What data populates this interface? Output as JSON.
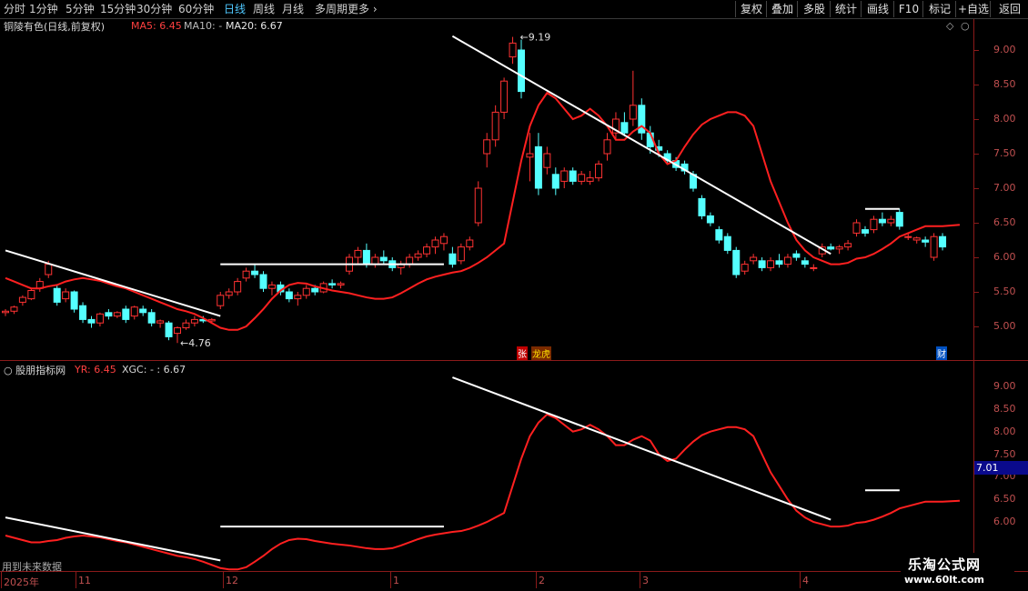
{
  "toolbar": {
    "timeframes": [
      "分时",
      "1分钟",
      "5分钟",
      "15分钟",
      "30分钟",
      "60分钟",
      "日线",
      "周线",
      "月线",
      "多周期",
      "更多"
    ],
    "active": "日线",
    "right_buttons": [
      "复权",
      "叠加",
      "多股",
      "统计",
      "画线",
      "F10",
      "标记",
      "+自选",
      "返回"
    ]
  },
  "main": {
    "stock_name": "铜陵有色(日线,前复权)",
    "ma5_label": "MA5: 6.45",
    "ma10_label": "MA10: -",
    "ma20_label": "MA20: 6.67",
    "high_label": "9.19",
    "low_label": "4.76",
    "yaxis": [
      "9.00",
      "8.50",
      "8.00",
      "7.50",
      "7.00",
      "6.50",
      "6.00",
      "5.50",
      "5.00"
    ],
    "marks": {
      "zhang": "张",
      "longhu": "龙虎",
      "cai": "财"
    }
  },
  "indicator": {
    "title": "股朋指标网",
    "yr": "YR: 6.45",
    "xgc": "XGC: - : 6.67",
    "yaxis": [
      "9.00",
      "8.50",
      "8.00",
      "7.50",
      "7.00",
      "6.50",
      "6.00"
    ],
    "current_value": "7.01",
    "note": "用到未来数据"
  },
  "dates": [
    "2025年",
    "11",
    "12",
    "1",
    "2",
    "3",
    "4"
  ],
  "watermark": {
    "line1": "乐淘公式网",
    "line2": "www.60lt.com"
  },
  "chart_data": {
    "type": "candlestick",
    "ylim": [
      4.6,
      9.4
    ],
    "candles": [
      [
        5.2,
        5.25,
        5.15,
        5.22
      ],
      [
        5.22,
        5.3,
        5.18,
        5.28
      ],
      [
        5.35,
        5.45,
        5.3,
        5.42
      ],
      [
        5.4,
        5.55,
        5.38,
        5.52
      ],
      [
        5.55,
        5.7,
        5.5,
        5.65
      ],
      [
        5.75,
        5.95,
        5.7,
        5.9
      ],
      [
        5.55,
        5.6,
        5.3,
        5.35
      ],
      [
        5.4,
        5.55,
        5.35,
        5.5
      ],
      [
        5.5,
        5.52,
        5.2,
        5.25
      ],
      [
        5.3,
        5.35,
        5.05,
        5.1
      ],
      [
        5.1,
        5.15,
        4.98,
        5.05
      ],
      [
        5.05,
        5.2,
        5.0,
        5.18
      ],
      [
        5.2,
        5.25,
        5.1,
        5.15
      ],
      [
        5.15,
        5.22,
        5.12,
        5.2
      ],
      [
        5.25,
        5.3,
        5.05,
        5.1
      ],
      [
        5.15,
        5.3,
        5.1,
        5.28
      ],
      [
        5.25,
        5.3,
        5.15,
        5.2
      ],
      [
        5.2,
        5.25,
        5.0,
        5.05
      ],
      [
        5.05,
        5.1,
        4.98,
        5.08
      ],
      [
        5.05,
        5.08,
        4.8,
        4.85
      ],
      [
        4.9,
        5.0,
        4.76,
        4.98
      ],
      [
        4.98,
        5.1,
        4.95,
        5.05
      ],
      [
        5.05,
        5.15,
        5.0,
        5.1
      ],
      [
        5.1,
        5.15,
        5.05,
        5.08
      ],
      [
        5.08,
        5.12,
        5.05,
        5.1
      ],
      [
        5.3,
        5.5,
        5.25,
        5.45
      ],
      [
        5.45,
        5.55,
        5.4,
        5.5
      ],
      [
        5.5,
        5.7,
        5.45,
        5.65
      ],
      [
        5.7,
        5.85,
        5.65,
        5.8
      ],
      [
        5.8,
        5.9,
        5.7,
        5.75
      ],
      [
        5.75,
        5.8,
        5.5,
        5.55
      ],
      [
        5.55,
        5.65,
        5.45,
        5.6
      ],
      [
        5.6,
        5.65,
        5.45,
        5.5
      ],
      [
        5.5,
        5.55,
        5.35,
        5.4
      ],
      [
        5.4,
        5.5,
        5.3,
        5.45
      ],
      [
        5.45,
        5.6,
        5.4,
        5.55
      ],
      [
        5.55,
        5.6,
        5.45,
        5.5
      ],
      [
        5.5,
        5.65,
        5.48,
        5.62
      ],
      [
        5.62,
        5.68,
        5.55,
        5.6
      ],
      [
        5.6,
        5.65,
        5.55,
        5.62
      ],
      [
        5.8,
        6.05,
        5.75,
        6.0
      ],
      [
        6.0,
        6.15,
        5.9,
        6.1
      ],
      [
        6.1,
        6.2,
        5.85,
        5.9
      ],
      [
        5.9,
        6.05,
        5.85,
        6.0
      ],
      [
        6.0,
        6.1,
        5.9,
        5.95
      ],
      [
        5.95,
        6.0,
        5.8,
        5.85
      ],
      [
        5.85,
        5.95,
        5.75,
        5.9
      ],
      [
        5.9,
        6.05,
        5.85,
        6.0
      ],
      [
        6.0,
        6.1,
        5.95,
        6.05
      ],
      [
        6.05,
        6.2,
        6.0,
        6.15
      ],
      [
        6.15,
        6.3,
        6.05,
        6.25
      ],
      [
        6.2,
        6.35,
        6.1,
        6.3
      ],
      [
        6.05,
        6.15,
        5.85,
        5.9
      ],
      [
        5.95,
        6.2,
        5.9,
        6.15
      ],
      [
        6.15,
        6.3,
        6.1,
        6.25
      ],
      [
        6.5,
        7.1,
        6.45,
        7.0
      ],
      [
        7.5,
        7.8,
        7.3,
        7.7
      ],
      [
        7.7,
        8.2,
        7.6,
        8.1
      ],
      [
        8.1,
        8.6,
        8.0,
        8.55
      ],
      [
        8.9,
        9.19,
        8.8,
        9.1
      ],
      [
        9.0,
        9.15,
        8.3,
        8.4
      ],
      [
        7.45,
        7.8,
        7.1,
        7.5
      ],
      [
        7.6,
        7.8,
        6.9,
        7.0
      ],
      [
        7.3,
        7.6,
        7.2,
        7.5
      ],
      [
        7.2,
        7.3,
        6.9,
        7.0
      ],
      [
        7.1,
        7.3,
        7.0,
        7.25
      ],
      [
        7.25,
        7.3,
        7.05,
        7.1
      ],
      [
        7.1,
        7.25,
        7.05,
        7.2
      ],
      [
        7.1,
        7.25,
        7.05,
        7.15
      ],
      [
        7.15,
        7.4,
        7.1,
        7.35
      ],
      [
        7.5,
        7.8,
        7.4,
        7.7
      ],
      [
        7.8,
        8.1,
        7.7,
        8.0
      ],
      [
        7.95,
        8.1,
        7.75,
        7.8
      ],
      [
        8.0,
        8.7,
        7.9,
        8.2
      ],
      [
        8.2,
        8.3,
        7.7,
        7.8
      ],
      [
        7.8,
        7.9,
        7.5,
        7.6
      ],
      [
        7.6,
        7.7,
        7.45,
        7.55
      ],
      [
        7.5,
        7.55,
        7.35,
        7.4
      ],
      [
        7.4,
        7.45,
        7.25,
        7.3
      ],
      [
        7.35,
        7.4,
        7.2,
        7.25
      ],
      [
        7.2,
        7.25,
        6.95,
        7.0
      ],
      [
        6.85,
        6.9,
        6.55,
        6.6
      ],
      [
        6.6,
        6.65,
        6.45,
        6.5
      ],
      [
        6.4,
        6.45,
        6.2,
        6.25
      ],
      [
        6.3,
        6.35,
        6.05,
        6.1
      ],
      [
        6.1,
        6.15,
        5.7,
        5.75
      ],
      [
        5.8,
        5.95,
        5.75,
        5.9
      ],
      [
        5.95,
        6.05,
        5.9,
        6.0
      ],
      [
        5.95,
        6.0,
        5.8,
        5.85
      ],
      [
        5.85,
        6.0,
        5.8,
        5.95
      ],
      [
        5.95,
        6.05,
        5.85,
        5.9
      ],
      [
        5.9,
        6.05,
        5.85,
        6.0
      ],
      [
        6.05,
        6.1,
        5.95,
        6.0
      ],
      [
        5.95,
        6.0,
        5.85,
        5.9
      ],
      [
        5.85,
        5.9,
        5.8,
        5.85
      ],
      [
        6.05,
        6.2,
        6.0,
        6.15
      ],
      [
        6.15,
        6.2,
        6.1,
        6.12
      ],
      [
        6.12,
        6.18,
        6.05,
        6.15
      ],
      [
        6.15,
        6.25,
        6.1,
        6.2
      ],
      [
        6.35,
        6.55,
        6.3,
        6.5
      ],
      [
        6.4,
        6.45,
        6.3,
        6.35
      ],
      [
        6.4,
        6.6,
        6.35,
        6.55
      ],
      [
        6.55,
        6.65,
        6.45,
        6.5
      ],
      [
        6.5,
        6.6,
        6.45,
        6.55
      ],
      [
        6.65,
        6.7,
        6.4,
        6.45
      ],
      [
        6.3,
        6.35,
        6.25,
        6.3
      ],
      [
        6.25,
        6.3,
        6.2,
        6.28
      ],
      [
        6.25,
        6.3,
        6.15,
        6.22
      ],
      [
        6.0,
        6.35,
        5.95,
        6.3
      ],
      [
        6.3,
        6.35,
        6.1,
        6.15
      ]
    ],
    "ma20": [
      5.7,
      5.65,
      5.6,
      5.55,
      5.55,
      5.58,
      5.6,
      5.65,
      5.68,
      5.7,
      5.68,
      5.66,
      5.62,
      5.58,
      5.55,
      5.5,
      5.45,
      5.4,
      5.35,
      5.3,
      5.25,
      5.22,
      5.18,
      5.12,
      5.05,
      4.98,
      4.95,
      4.95,
      5.0,
      5.12,
      5.25,
      5.4,
      5.52,
      5.6,
      5.63,
      5.62,
      5.58,
      5.55,
      5.52,
      5.5,
      5.48,
      5.45,
      5.42,
      5.4,
      5.4,
      5.42,
      5.48,
      5.55,
      5.62,
      5.68,
      5.72,
      5.75,
      5.78,
      5.8,
      5.85,
      5.92,
      6.0,
      6.1,
      6.2,
      6.8,
      7.4,
      7.9,
      8.2,
      8.38,
      8.3,
      8.15,
      8.0,
      8.05,
      8.15,
      8.05,
      7.9,
      7.7,
      7.7,
      7.82,
      7.9,
      7.8,
      7.5,
      7.35,
      7.4,
      7.6,
      7.78,
      7.92,
      8.0,
      8.05,
      8.1,
      8.1,
      8.05,
      7.9,
      7.5,
      7.1,
      6.8,
      6.5,
      6.25,
      6.1,
      6.0,
      5.95,
      5.9,
      5.9,
      5.92,
      5.98,
      6.0,
      6.05,
      6.12,
      6.2,
      6.3,
      6.35,
      6.4,
      6.45,
      6.45,
      6.45,
      6.46,
      6.47
    ],
    "trendlines": [
      {
        "from": [
          0,
          6.1
        ],
        "to": [
          25,
          5.15
        ]
      },
      {
        "from": [
          25,
          5.9
        ],
        "to": [
          51,
          5.9
        ]
      },
      {
        "from": [
          52,
          9.2
        ],
        "to": [
          96,
          6.05
        ]
      },
      {
        "from": [
          100,
          6.7
        ],
        "to": [
          104,
          6.7
        ]
      }
    ]
  }
}
